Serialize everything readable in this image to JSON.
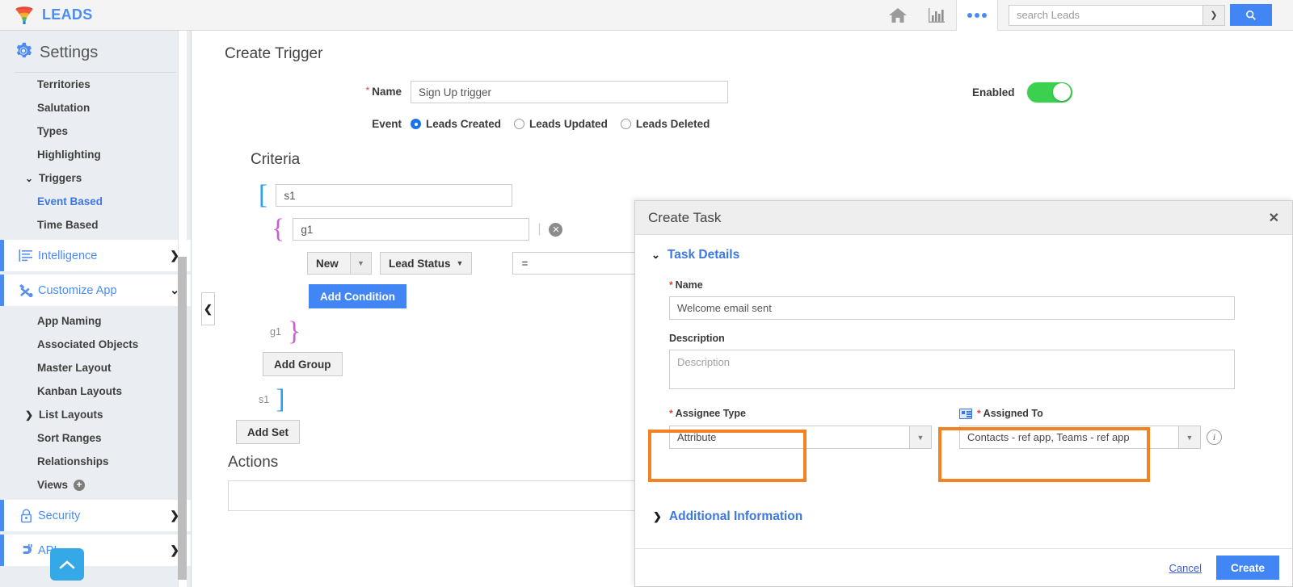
{
  "topbar": {
    "brand": "LEADS",
    "brand_icon": "funnel-icon",
    "home_icon": "home-icon",
    "reports_icon": "bar-chart-icon",
    "more_icon": "more-dots-icon",
    "search_placeholder": "search Leads",
    "search_value": "",
    "search_caret_icon": "chevron-down-icon",
    "search_button_icon": "search-icon"
  },
  "sidebar": {
    "title": "Settings",
    "gear_icon": "gear-icon",
    "leaf_items_top": [
      {
        "label": "Territories",
        "active": false
      },
      {
        "label": "Salutation",
        "active": false
      },
      {
        "label": "Types",
        "active": false
      },
      {
        "label": "Highlighting",
        "active": false
      }
    ],
    "triggers": {
      "label": "Triggers",
      "chevron": "⌄",
      "children": [
        {
          "label": "Event Based",
          "active": true
        },
        {
          "label": "Time Based",
          "active": false
        }
      ]
    },
    "intelligence": {
      "label": "Intelligence",
      "icon": "list-lines-icon",
      "arrow": "❯"
    },
    "customize_app": {
      "label": "Customize App",
      "icon": "tools-icon",
      "arrow": "⌄"
    },
    "customize_children": [
      {
        "label": "App Naming",
        "expandable": false
      },
      {
        "label": "Associated Objects",
        "expandable": false
      },
      {
        "label": "Master Layout",
        "expandable": false
      },
      {
        "label": "Kanban Layouts",
        "expandable": false
      },
      {
        "label": "List Layouts",
        "expandable": true
      },
      {
        "label": "Sort Ranges",
        "expandable": false
      },
      {
        "label": "Relationships",
        "expandable": false
      }
    ],
    "views": {
      "label": "Views",
      "add_icon": "plus-circle-icon"
    },
    "security": {
      "label": "Security",
      "icon": "lock-icon",
      "arrow": "❯"
    },
    "api": {
      "label": "API",
      "icon": "plug-icon",
      "arrow": "❯"
    },
    "collapse_handle_icon": "chevron-left-icon",
    "scroll_top_icon": "chevron-up-icon"
  },
  "main": {
    "page_title": "Create Trigger",
    "name_label": "Name",
    "name_value": "Sign Up trigger",
    "enabled_label": "Enabled",
    "enabled_on": true,
    "event_label": "Event",
    "event_options": [
      {
        "label": "Leads Created",
        "checked": true
      },
      {
        "label": "Leads Updated",
        "checked": false
      },
      {
        "label": "Leads Deleted",
        "checked": false
      }
    ],
    "criteria_title": "Criteria",
    "set_input_value": "s1",
    "group_input_value": "g1",
    "group_clear_icon": "clear-circle-icon",
    "condition": {
      "value_select": "New",
      "field_select": "Lead Status",
      "operator_select": "="
    },
    "add_condition_label": "Add Condition",
    "group_close_tag": "g1",
    "add_group_label": "Add Group",
    "set_close_tag": "s1",
    "add_set_label": "Add Set",
    "actions_title": "Actions"
  },
  "modal": {
    "title": "Create Task",
    "close_icon": "close-icon",
    "task_details_label": "Task Details",
    "task_details_chevron": "⌄",
    "name_label": "Name",
    "name_value": "Welcome email sent",
    "description_label": "Description",
    "description_value": "",
    "description_placeholder": "Description",
    "assignee_type_label": "Assignee Type",
    "assignee_type_value": "Attribute",
    "assigned_to_label": "Assigned To",
    "assigned_to_value": "Contacts - ref app, Teams - ref app",
    "assigned_to_icon": "contact-card-icon",
    "info_icon": "info-icon",
    "additional_info_label": "Additional Information",
    "additional_info_chevron": "❯",
    "cancel_label": "Cancel",
    "create_label": "Create",
    "highlight_color": "#f58220"
  }
}
